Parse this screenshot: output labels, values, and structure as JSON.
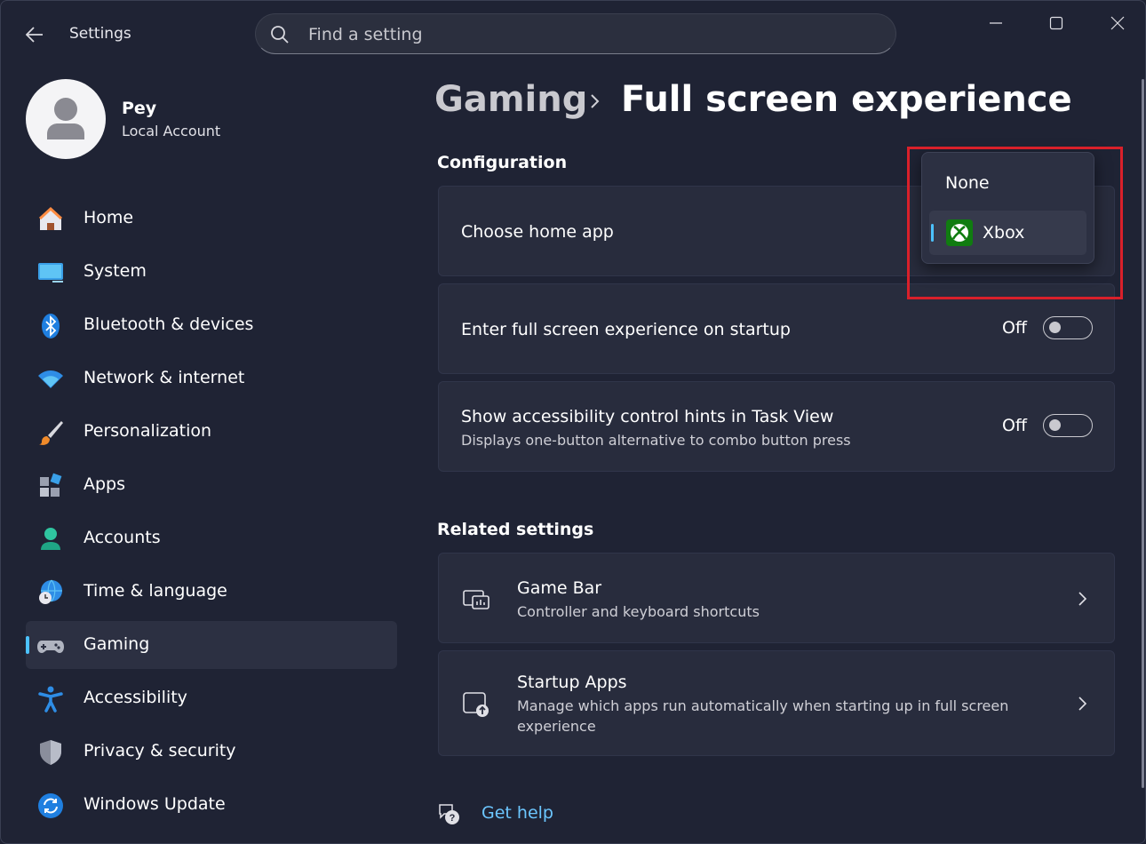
{
  "titlebar": {
    "app_title": "Settings"
  },
  "search": {
    "placeholder": "Find a setting"
  },
  "profile": {
    "name": "Pey",
    "account_type": "Local Account"
  },
  "sidebar": {
    "items": [
      {
        "label": "Home",
        "icon": "home-icon"
      },
      {
        "label": "System",
        "icon": "monitor-icon"
      },
      {
        "label": "Bluetooth & devices",
        "icon": "bluetooth-icon"
      },
      {
        "label": "Network & internet",
        "icon": "wifi-icon"
      },
      {
        "label": "Personalization",
        "icon": "brush-icon"
      },
      {
        "label": "Apps",
        "icon": "apps-icon"
      },
      {
        "label": "Accounts",
        "icon": "person-icon"
      },
      {
        "label": "Time & language",
        "icon": "globe-clock-icon"
      },
      {
        "label": "Gaming",
        "icon": "gamepad-icon",
        "selected": true
      },
      {
        "label": "Accessibility",
        "icon": "accessibility-icon"
      },
      {
        "label": "Privacy & security",
        "icon": "shield-icon"
      },
      {
        "label": "Windows Update",
        "icon": "update-icon"
      }
    ]
  },
  "breadcrumb": {
    "parent": "Gaming",
    "current": "Full screen experience"
  },
  "configuration": {
    "heading": "Configuration",
    "home_app": {
      "title": "Choose home app"
    },
    "startup": {
      "title": "Enter full screen experience on startup",
      "state": "Off"
    },
    "hints": {
      "title": "Show accessibility control hints in Task View",
      "description": "Displays one-button alternative to combo button press",
      "state": "Off"
    }
  },
  "dropdown": {
    "options": [
      {
        "label": "None"
      },
      {
        "label": "Xbox",
        "selected": true,
        "icon": "xbox-icon"
      }
    ]
  },
  "related": {
    "heading": "Related settings",
    "items": [
      {
        "title": "Game Bar",
        "description": "Controller and keyboard shortcuts",
        "icon": "game-bar-icon"
      },
      {
        "title": "Startup Apps",
        "description": "Manage which apps run automatically when starting up in full screen experience",
        "icon": "startup-apps-icon"
      }
    ]
  },
  "help": {
    "label": "Get help"
  },
  "colors": {
    "accent": "#4cc2ff",
    "highlight_box": "#d9202a",
    "xbox_green": "#107c10"
  }
}
